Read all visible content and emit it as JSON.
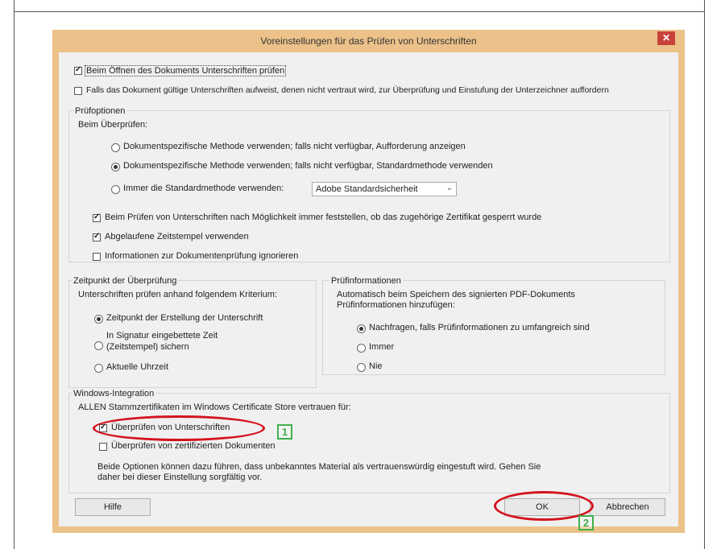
{
  "dialog": {
    "title": "Voreinstellungen für das Prüfen von Unterschriften",
    "close_label": "✕"
  },
  "top": {
    "verify_on_open": {
      "label": "Beim Öffnen des Dokuments Unterschriften prüfen",
      "checked": true
    },
    "prompt_signers": {
      "label": "Falls das Dokument gültige Unterschriften aufweist, denen nicht vertraut wird, zur Überprüfung und Einstufung der Unterzeichner auffordern",
      "checked": false
    }
  },
  "pruefoptionen": {
    "title": "Prüfoptionen",
    "sub": "Beim Überprüfen:",
    "radio1": "Dokumentspezifische Methode verwenden; falls nicht verfügbar, Aufforderung anzeigen",
    "radio2": "Dokumentspezifische Methode verwenden; falls nicht verfügbar, Standardmethode verwenden",
    "radio3": "Immer die Standardmethode verwenden:",
    "select_value": "Adobe Standardsicherheit",
    "check1": "Beim Prüfen von Unterschriften nach Möglichkeit immer feststellen, ob das zugehörige Zertifikat gesperrt wurde",
    "check2": "Abgelaufene Zeitstempel verwenden",
    "check3": "Informationen zur Dokumentenprüfung ignorieren"
  },
  "zeitpunkt": {
    "title": "Zeitpunkt der Überprüfung",
    "sub": "Unterschriften prüfen anhand folgendem Kriterium:",
    "radio1": "Zeitpunkt der Erstellung der Unterschrift",
    "radio2_line1": "In Signatur eingebettete Zeit",
    "radio2_line2": "(Zeitstempel) sichern",
    "radio3": "Aktuelle Uhrzeit"
  },
  "pruefinfo": {
    "title": "Prüfinformationen",
    "sub_line1": "Automatisch beim Speichern des signierten PDF-Dokuments",
    "sub_line2": "Prüfinformationen hinzufügen:",
    "radio1": "Nachfragen, falls Prüfinformationen zu umfangreich sind",
    "radio2": "Immer",
    "radio3": "Nie"
  },
  "windows": {
    "title": "Windows-Integration",
    "sub": "ALLEN Stammzertifikaten im Windows Certificate Store vertrauen für:",
    "check1": "Überprüfen von Unterschriften",
    "check2": "Überprüfen von zertifizierten Dokumenten",
    "note_line1": "Beide Optionen können dazu führen, dass unbekanntes Material als vertrauenswürdig eingestuft wird. Gehen Sie",
    "note_line2": "daher bei dieser Einstellung sorgfältig vor."
  },
  "buttons": {
    "help": "Hilfe",
    "ok": "OK",
    "cancel": "Abbrechen"
  },
  "annotations": {
    "badge1": "1",
    "badge2": "2",
    "highlight_color": "#d4121d",
    "badge_color": "#3fb04a"
  }
}
